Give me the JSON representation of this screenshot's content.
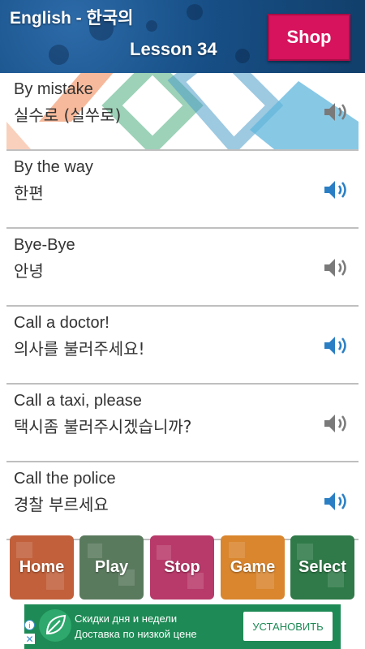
{
  "header": {
    "app_title": "English - 한국의",
    "lesson_title": "Lesson 34",
    "shop_label": "Shop"
  },
  "phrases": [
    {
      "en": "By mistake",
      "ko": "실수로 (실쑤로)",
      "speaker": "speaker-gray"
    },
    {
      "en": "By the way",
      "ko": "한편",
      "speaker": "speaker-blue"
    },
    {
      "en": "Bye-Bye",
      "ko": "안녕",
      "speaker": "speaker-gray"
    },
    {
      "en": "Call a doctor!",
      "ko": "의사를 불러주세요!",
      "speaker": "speaker-blue"
    },
    {
      "en": "Call a taxi, please",
      "ko": "택시좀 불러주시겠습니까?",
      "speaker": "speaker-gray"
    },
    {
      "en": "Call the police",
      "ko": "경찰 부르세요",
      "speaker": "speaker-blue"
    }
  ],
  "nav": {
    "home": "Home",
    "play": "Play",
    "stop": "Stop",
    "game": "Game",
    "select": "Select"
  },
  "ad": {
    "line1": "Скидки дня и недели",
    "line2": "Доставка по низкой цене",
    "install_label": "УСТАНОВИТЬ",
    "info_glyph": "i",
    "close_glyph": "✕"
  },
  "colors": {
    "header_bg": "#174f86",
    "shop": "#d6135c",
    "speaker_blue": "#2a7fc4",
    "speaker_gray": "#7a7a7a",
    "home": "#c1603b",
    "play": "#5a7a5e",
    "stop": "#b83a6a",
    "game": "#d9862e",
    "select": "#2f7a48",
    "ad_bg": "#1e8a55"
  }
}
